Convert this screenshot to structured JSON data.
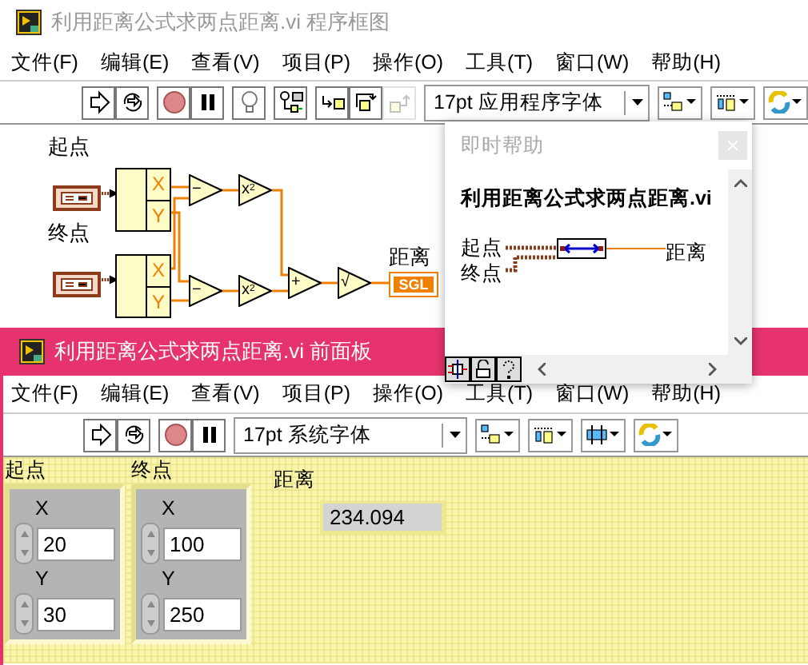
{
  "diagram_window": {
    "title": "利用距离公式求两点距离.vi 程序框图",
    "menu": [
      "文件(F)",
      "编辑(E)",
      "查看(V)",
      "项目(P)",
      "操作(O)",
      "工具(T)",
      "窗口(W)",
      "帮助(H)"
    ],
    "toolbar": [
      [
        {
          "kind": "run",
          "disabled": false
        },
        {
          "kind": "run_continuous",
          "disabled": false
        }
      ],
      [
        {
          "kind": "abort",
          "disabled": false
        },
        {
          "kind": "pause",
          "disabled": false
        }
      ],
      [
        {
          "kind": "highlight",
          "disabled": false
        }
      ],
      [
        {
          "kind": "retain",
          "disabled": false
        }
      ],
      [
        {
          "kind": "step_into",
          "disabled": false
        },
        {
          "kind": "step_over",
          "disabled": false
        },
        {
          "kind": "step_out",
          "disabled": true
        }
      ]
    ],
    "font": "17pt 应用程序字体",
    "tools": [
      {
        "kind": "align"
      },
      {
        "kind": "distribute"
      },
      {
        "kind": "cleanup"
      }
    ],
    "diagram": {
      "controls": [
        {
          "label": "起点",
          "fields": [
            "X",
            "Y"
          ]
        },
        {
          "label": "终点",
          "fields": [
            "X",
            "Y"
          ]
        }
      ],
      "functions": [
        {
          "symbol": "−"
        },
        {
          "symbol": "x$^{2}$"
        },
        {
          "symbol": "−"
        },
        {
          "symbol": "x$^{2}$"
        },
        {
          "symbol": "+"
        },
        {
          "symbol": "√"
        }
      ],
      "indicator": {
        "label": "距离",
        "type": "SGL"
      }
    }
  },
  "help_window": {
    "title": "即时帮助",
    "vi_name": "利用距离公式求两点距离.vi",
    "inputs": [
      "起点",
      "终点"
    ],
    "output": "距离"
  },
  "front_panel_window": {
    "title": "利用距离公式求两点距离.vi 前面板",
    "menu": [
      "文件(F)",
      "编辑(E)",
      "查看(V)",
      "项目(P)",
      "操作(O)",
      "工具(T)",
      "窗口(W)",
      "帮助(H)"
    ],
    "toolbar": [
      [
        {
          "kind": "run",
          "disabled": false
        },
        {
          "kind": "run_continuous",
          "disabled": false
        }
      ],
      [
        {
          "kind": "abort",
          "disabled": false
        },
        {
          "kind": "pause",
          "disabled": false
        }
      ]
    ],
    "font": "17pt 系统字体",
    "tools": [
      {
        "kind": "align"
      },
      {
        "kind": "distribute"
      },
      {
        "kind": "resize"
      },
      {
        "kind": "reorder"
      }
    ],
    "controls": [
      {
        "label": "起点",
        "fields": [
          {
            "name": "X",
            "value": "20"
          },
          {
            "name": "Y",
            "value": "30"
          }
        ]
      },
      {
        "label": "终点",
        "fields": [
          {
            "name": "X",
            "value": "100"
          },
          {
            "name": "Y",
            "value": "250"
          }
        ]
      }
    ],
    "indicator": {
      "label": "距离",
      "value": "234.094"
    }
  }
}
